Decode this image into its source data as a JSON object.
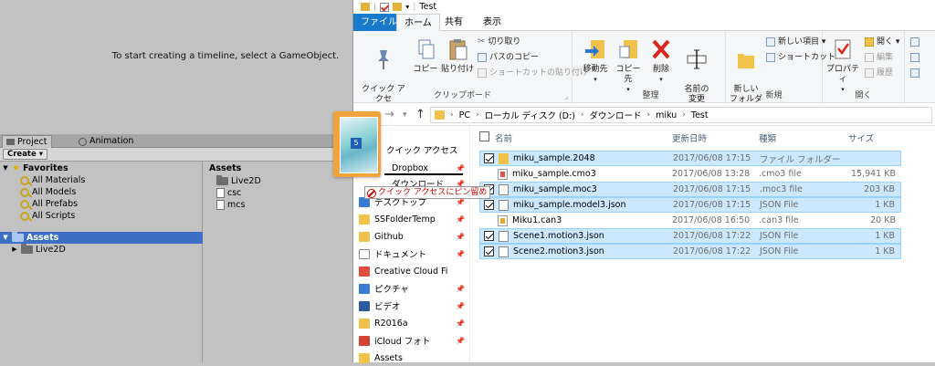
{
  "unity": {
    "timeline_message": "To start creating a timeline, select a GameObject.",
    "tabs": [
      {
        "label": "Project"
      },
      {
        "label": "Animation"
      }
    ],
    "create_label": "Create ▾",
    "favorites": {
      "title": "Favorites",
      "items": [
        {
          "label": "All Materials"
        },
        {
          "label": "All Models"
        },
        {
          "label": "All Prefabs"
        },
        {
          "label": "All Scripts"
        }
      ]
    },
    "assets_tree": {
      "label": "Assets",
      "child": "Live2D"
    },
    "assets_panel": {
      "header": "Assets",
      "folder": "Live2D",
      "files": [
        {
          "label": "csc"
        },
        {
          "label": "mcs"
        }
      ]
    }
  },
  "explorer": {
    "window_title": "Test",
    "tabs": {
      "file": "ファイル",
      "home": "ホーム",
      "share": "共有",
      "view": "表示"
    },
    "ribbon": {
      "pin_quick_access": "クイック アクセ\nスにピン留め",
      "copy": "コピー",
      "paste": "貼り付け",
      "cut": "切り取り",
      "copy_path": "パスのコピー",
      "paste_shortcut": "ショートカットの貼り付け",
      "clipboard_label": "クリップボード",
      "move_to": "移動先",
      "copy_to": "コピー先",
      "delete": "削除",
      "rename": "名前の\n変更",
      "organize_label": "整理",
      "new_folder": "新しい\nフォルダー",
      "new_item": "新しい項目 ▾",
      "shortcut": "ショートカット ▾",
      "new_label": "新規",
      "properties": "プロパティ",
      "open": "開く ▾",
      "edit": "編集",
      "history": "履歴",
      "open_label": "開く"
    },
    "breadcrumbs": [
      "PC",
      "ローカル ディスク (D:)",
      "ダウンロード",
      "miku",
      "Test"
    ],
    "nav": {
      "quick_access": "クイック アクセス",
      "items": [
        {
          "label": "Dropbox"
        },
        {
          "label": "ダウンロード"
        },
        {
          "label": "デスクトップ"
        },
        {
          "label": "SSFolderTemp"
        },
        {
          "label": "Github"
        },
        {
          "label": "ドキュメント"
        },
        {
          "label": "Creative Cloud Fi"
        },
        {
          "label": "ピクチャ"
        },
        {
          "label": "ビデオ"
        },
        {
          "label": "R2016a"
        },
        {
          "label": "iCloud フォト"
        },
        {
          "label": "Assets"
        }
      ]
    },
    "columns": {
      "name": "名前",
      "date": "更新日時",
      "type": "種類",
      "size": "サイズ"
    },
    "files": [
      {
        "name": "miku_sample.2048",
        "date": "2017/06/08 17:15",
        "type": "ファイル フォルダー",
        "size": "",
        "selected": true
      },
      {
        "name": "miku_sample.cmo3",
        "date": "2017/06/08 13:28",
        "type": ".cmo3 file",
        "size": "15,941 KB",
        "selected": false
      },
      {
        "name": "miku_sample.moc3",
        "date": "2017/06/08 17:15",
        "type": ".moc3 file",
        "size": "203 KB",
        "selected": true
      },
      {
        "name": "miku_sample.model3.json",
        "date": "2017/06/08 17:15",
        "type": "JSON File",
        "size": "1 KB",
        "selected": true
      },
      {
        "name": "Miku1.can3",
        "date": "2017/06/08 16:50",
        "type": ".can3 file",
        "size": "20 KB",
        "selected": false
      },
      {
        "name": "Scene1.motion3.json",
        "date": "2017/06/08 17:22",
        "type": "JSON File",
        "size": "1 KB",
        "selected": true
      },
      {
        "name": "Scene2.motion3.json",
        "date": "2017/06/08 17:22",
        "type": "JSON File",
        "size": "1 KB",
        "selected": true
      }
    ],
    "drag": {
      "badge": "5",
      "tooltip": "クイック アクセスにピン留め"
    }
  }
}
